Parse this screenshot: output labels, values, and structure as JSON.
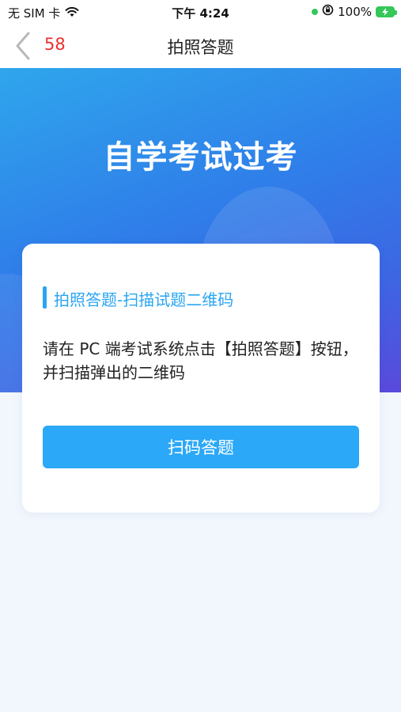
{
  "status_bar": {
    "carrier": "无 SIM 卡",
    "time": "下午 4:24",
    "battery": "100%",
    "icons": [
      "wifi-icon",
      "location-dot-icon",
      "orientation-lock-icon",
      "battery-charging-icon"
    ]
  },
  "nav": {
    "back_icon": "chevron-left-icon",
    "count": "58",
    "title": "拍照答题"
  },
  "hero": {
    "title": "自学考试过考"
  },
  "card": {
    "section_title": "拍照答题-扫描试题二维码",
    "instruction": "请在 PC 端考试系统点击【拍照答题】按钮，并扫描弹出的二维码",
    "button_label": "扫码答题"
  },
  "colors": {
    "accent": "#2ba8f7",
    "count_red": "#e8322f",
    "hero_gradient_start": "#2fa6ec",
    "hero_gradient_end": "#5a49dc",
    "page_background": "#f2f7fd"
  }
}
